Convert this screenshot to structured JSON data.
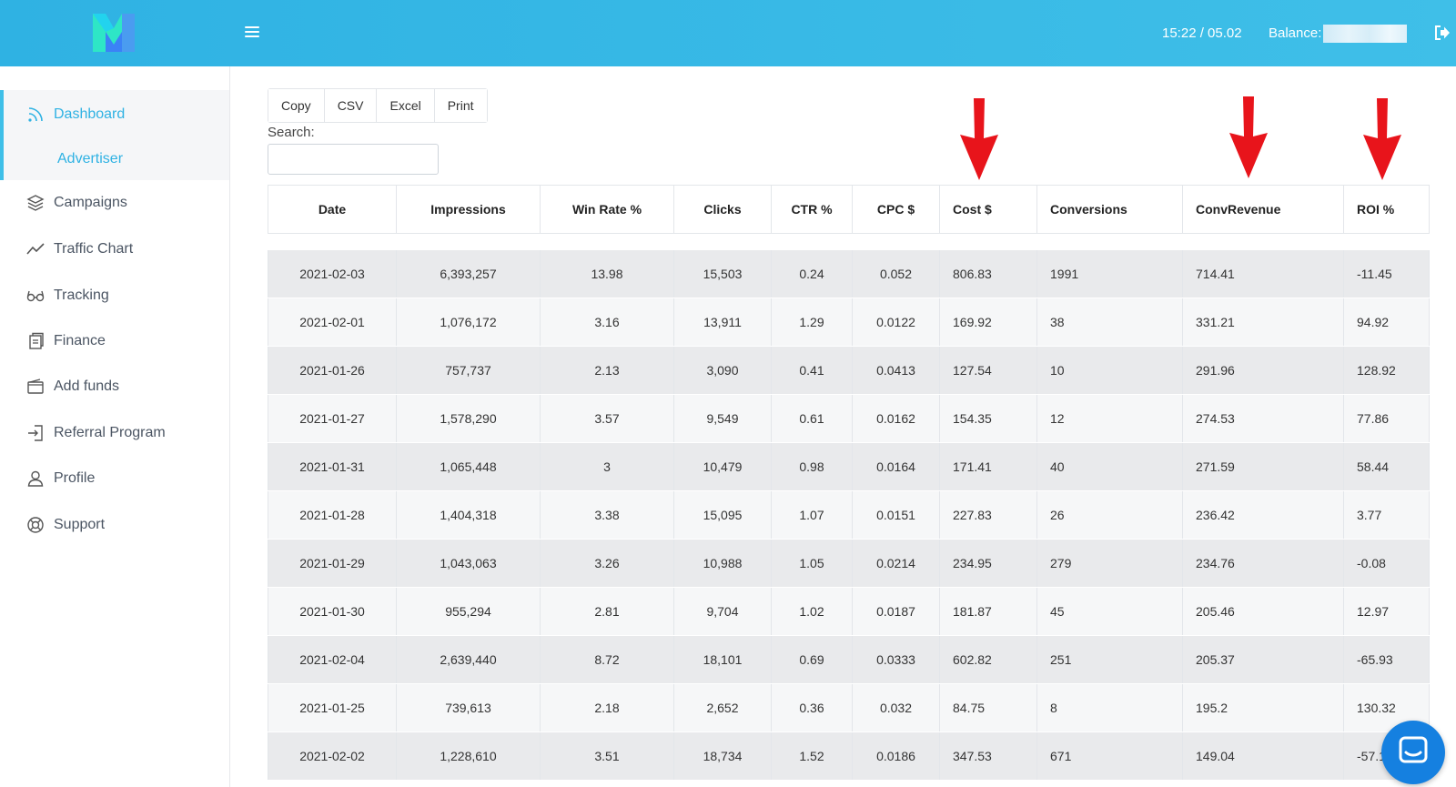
{
  "header": {
    "time": "15:22 / 05.02",
    "balance_label": "Balance:",
    "balance_value": "",
    "accent_color": "#3fbfe8"
  },
  "sidebar": {
    "items": [
      {
        "label": "Dashboard",
        "icon": "rss-icon",
        "active": true
      },
      {
        "label": "Advertiser",
        "icon": "",
        "sub": true
      },
      {
        "label": "Campaigns",
        "icon": "layers-icon"
      },
      {
        "label": "Traffic Chart",
        "icon": "chart-line-icon"
      },
      {
        "label": "Tracking",
        "icon": "glasses-icon"
      },
      {
        "label": "Finance",
        "icon": "document-icon"
      },
      {
        "label": "Add funds",
        "icon": "wallet-icon"
      },
      {
        "label": "Referral Program",
        "icon": "sign-in-icon"
      },
      {
        "label": "Profile",
        "icon": "user-icon"
      },
      {
        "label": "Support",
        "icon": "lifebuoy-icon"
      }
    ]
  },
  "toolbar": {
    "buttons": [
      "Copy",
      "CSV",
      "Excel",
      "Print"
    ],
    "search_label": "Search:",
    "search_value": ""
  },
  "table": {
    "columns": [
      "Date",
      "Impressions",
      "Win Rate %",
      "Clicks",
      "CTR %",
      "CPC $",
      "Cost $",
      "Conversions",
      "ConvRevenue",
      "ROI %"
    ],
    "rows": [
      [
        "2021-02-03",
        "6,393,257",
        "13.98",
        "15,503",
        "0.24",
        "0.052",
        "806.83",
        "1991",
        "714.41",
        "-11.45"
      ],
      [
        "2021-02-01",
        "1,076,172",
        "3.16",
        "13,911",
        "1.29",
        "0.0122",
        "169.92",
        "38",
        "331.21",
        "94.92"
      ],
      [
        "2021-01-26",
        "757,737",
        "2.13",
        "3,090",
        "0.41",
        "0.0413",
        "127.54",
        "10",
        "291.96",
        "128.92"
      ],
      [
        "2021-01-27",
        "1,578,290",
        "3.57",
        "9,549",
        "0.61",
        "0.0162",
        "154.35",
        "12",
        "274.53",
        "77.86"
      ],
      [
        "2021-01-31",
        "1,065,448",
        "3",
        "10,479",
        "0.98",
        "0.0164",
        "171.41",
        "40",
        "271.59",
        "58.44"
      ],
      [
        "2021-01-28",
        "1,404,318",
        "3.38",
        "15,095",
        "1.07",
        "0.0151",
        "227.83",
        "26",
        "236.42",
        "3.77"
      ],
      [
        "2021-01-29",
        "1,043,063",
        "3.26",
        "10,988",
        "1.05",
        "0.0214",
        "234.95",
        "279",
        "234.76",
        "-0.08"
      ],
      [
        "2021-01-30",
        "955,294",
        "2.81",
        "9,704",
        "1.02",
        "0.0187",
        "181.87",
        "45",
        "205.46",
        "12.97"
      ],
      [
        "2021-02-04",
        "2,639,440",
        "8.72",
        "18,101",
        "0.69",
        "0.0333",
        "602.82",
        "251",
        "205.37",
        "-65.93"
      ],
      [
        "2021-01-25",
        "739,613",
        "2.18",
        "2,652",
        "0.36",
        "0.032",
        "84.75",
        "8",
        "195.2",
        "130.32"
      ],
      [
        "2021-02-02",
        "1,228,610",
        "3.51",
        "18,734",
        "1.52",
        "0.0186",
        "347.53",
        "671",
        "149.04",
        "-57.1"
      ]
    ]
  },
  "annotations": {
    "arrow_color": "#e8141b",
    "arrows": [
      "arrow-cost",
      "arrow-convrevenue",
      "arrow-roi"
    ]
  },
  "chat": {
    "icon": "chat-icon",
    "color": "#1580e0"
  }
}
